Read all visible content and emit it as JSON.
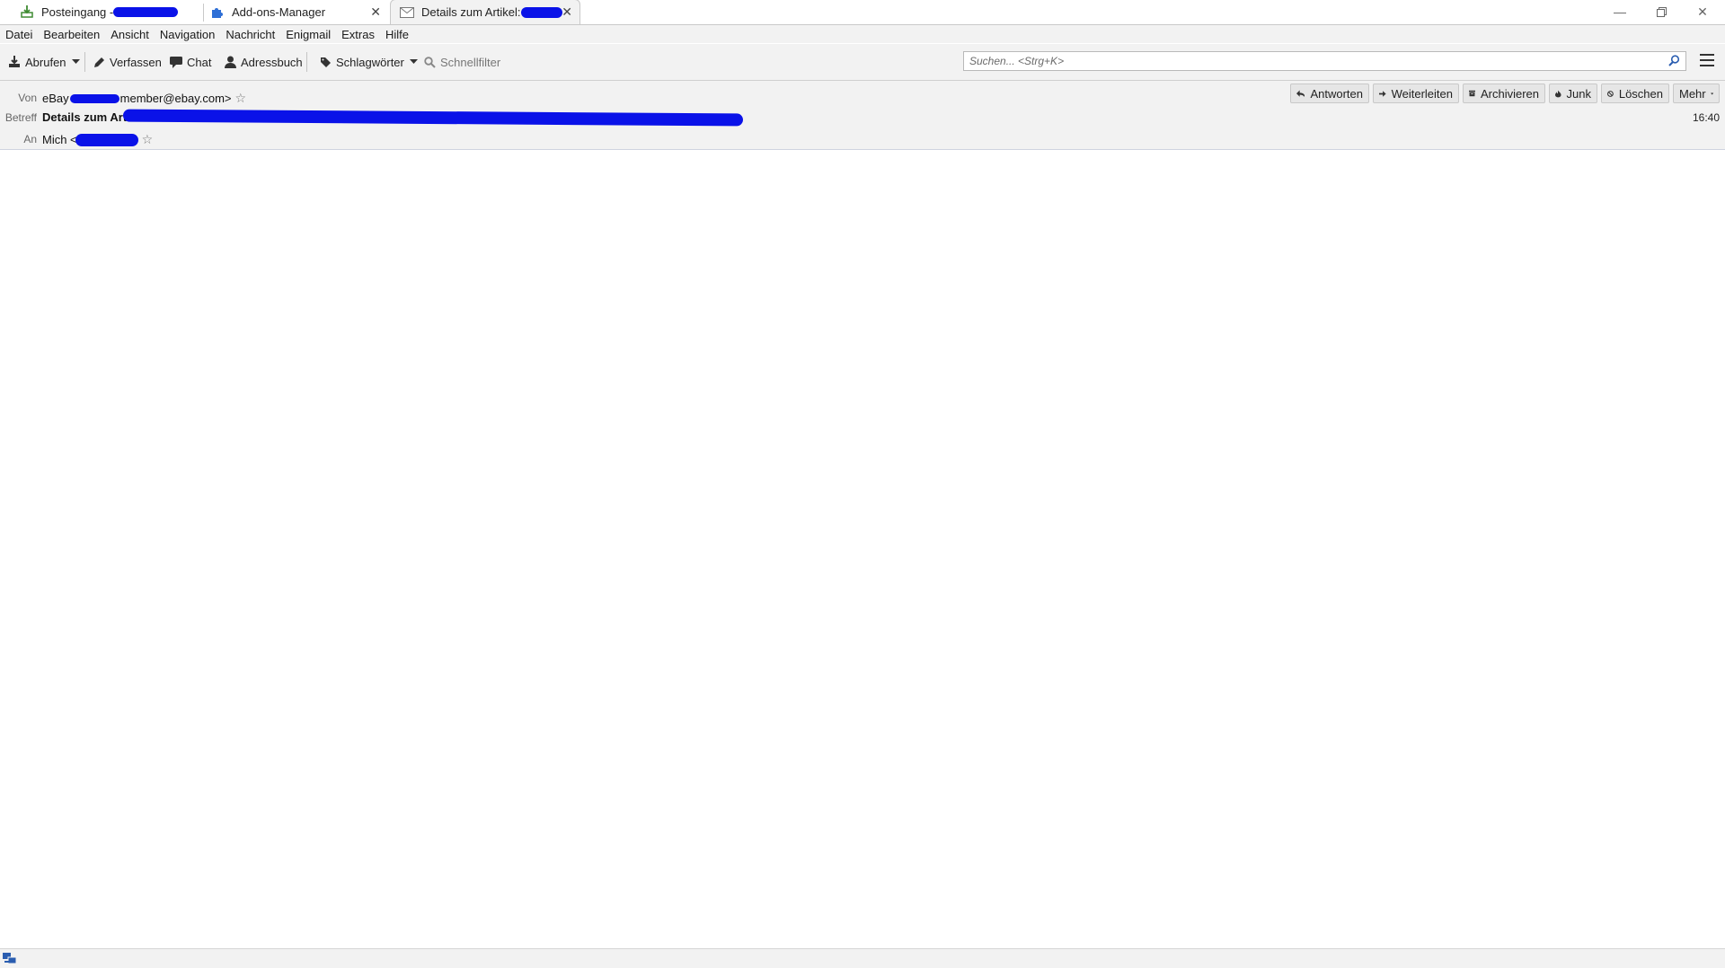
{
  "tabs": [
    {
      "label": "Posteingang - ",
      "icon": "inbox-download-icon"
    },
    {
      "label": "Add-ons-Manager",
      "icon": "puzzle-piece-icon"
    },
    {
      "label": "Details zum Artikel:",
      "icon": "envelope-icon"
    }
  ],
  "menu": [
    "Datei",
    "Bearbeiten",
    "Ansicht",
    "Navigation",
    "Nachricht",
    "Enigmail",
    "Extras",
    "Hilfe"
  ],
  "toolbar": {
    "get_mail": "Abrufen",
    "compose": "Verfassen",
    "chat": "Chat",
    "address_book": "Adressbuch",
    "tags": "Schlagwörter",
    "quick_filter": "Schnellfilter",
    "search_placeholder": "Suchen... <Strg+K>"
  },
  "header": {
    "from_label": "Von",
    "from_value_prefix": "eBay ",
    "from_value_suffix": "member@ebay.com>",
    "subject_label": "Betreff",
    "subject_value": "Details zum Arti",
    "to_label": "An",
    "to_value": "Mich <",
    "time": "16:40",
    "buttons": {
      "reply": "Antworten",
      "forward": "Weiterleiten",
      "archive": "Archivieren",
      "junk": "Junk",
      "delete": "Löschen",
      "more": "Mehr"
    }
  },
  "colors": {
    "redaction": "#0a12e8",
    "chrome": "#f2f2f2"
  }
}
